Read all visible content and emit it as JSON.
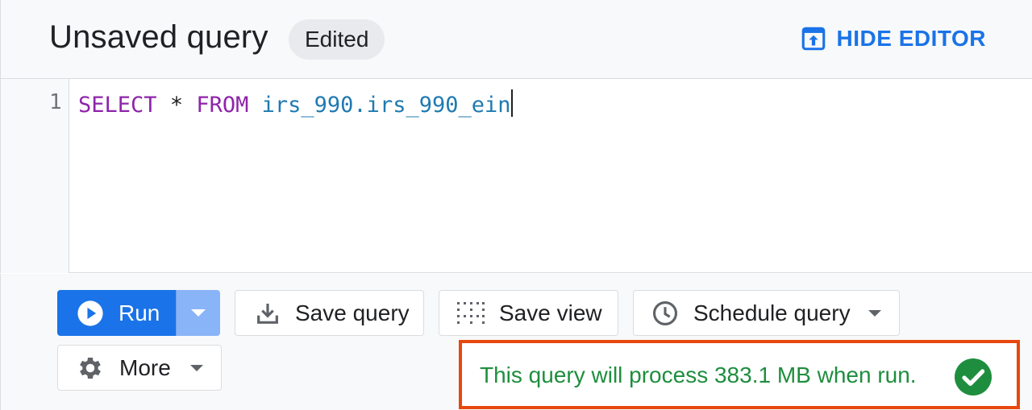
{
  "header": {
    "title": "Unsaved query",
    "chip": "Edited",
    "hide_editor": "HIDE EDITOR"
  },
  "editor": {
    "line_number": "1",
    "tokens": {
      "select": "SELECT",
      "star": "*",
      "from": "FROM",
      "table": "irs_990.irs_990_ein"
    }
  },
  "toolbar": {
    "run": "Run",
    "save_query": "Save query",
    "save_view": "Save view",
    "schedule_query": "Schedule query",
    "more": "More"
  },
  "status": {
    "message": "This query will process 383.1 MB when run."
  },
  "colors": {
    "accent": "#1a73e8",
    "success": "#1e8e3e",
    "highlight_border": "#e8470e"
  },
  "icons": {
    "hide_editor": "hide-editor-icon",
    "run": "play-circle-icon",
    "save_query": "download-icon",
    "save_view": "grid-dots-icon",
    "schedule_query": "clock-icon",
    "more": "gear-icon",
    "status": "check-circle-icon"
  }
}
